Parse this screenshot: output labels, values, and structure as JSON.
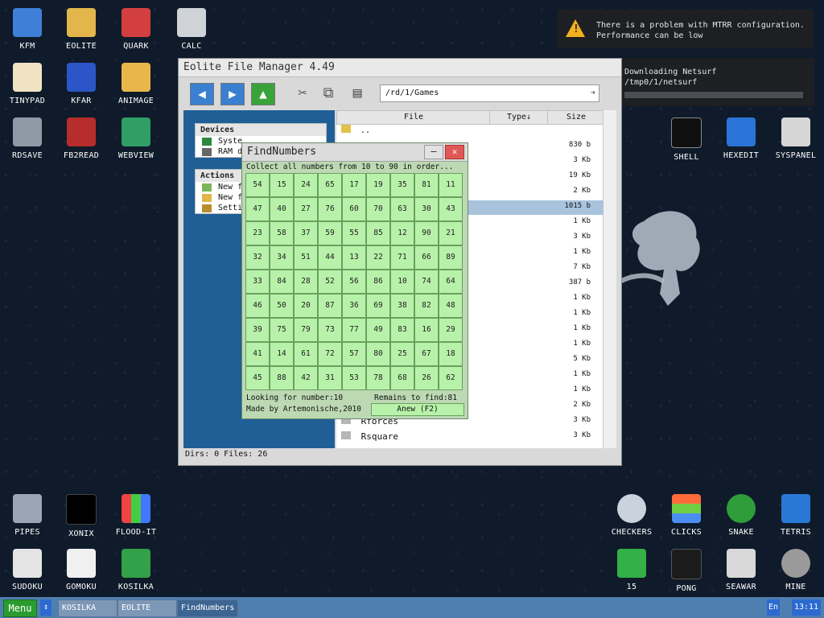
{
  "desktop": {
    "icons": [
      {
        "label": "KFM"
      },
      {
        "label": "EOLITE"
      },
      {
        "label": "QUARK"
      },
      {
        "label": "CALC"
      },
      {
        "label": "TINYPAD"
      },
      {
        "label": "KFAR"
      },
      {
        "label": "ANIMAGE"
      },
      {
        "label": "RDSAVE"
      },
      {
        "label": "FB2READ"
      },
      {
        "label": "WEBVIEW"
      },
      {
        "label": "SHELL"
      },
      {
        "label": "HEXEDIT"
      },
      {
        "label": "SYSPANEL"
      },
      {
        "label": "PIPES"
      },
      {
        "label": "XONIX"
      },
      {
        "label": "FLOOD-IT"
      },
      {
        "label": "SUDOKU"
      },
      {
        "label": "GOMOKU"
      },
      {
        "label": "KOSILKA"
      },
      {
        "label": "CHECKERS"
      },
      {
        "label": "CLICKS"
      },
      {
        "label": "SNAKE"
      },
      {
        "label": "TETRIS"
      },
      {
        "label": "15"
      },
      {
        "label": "PONG"
      },
      {
        "label": "SEAWAR"
      },
      {
        "label": "MINE"
      }
    ]
  },
  "notifications": {
    "mtrr": {
      "line1": "There is a problem with MTRR configuration.",
      "line2": "Performance can be low"
    },
    "download": {
      "title": "Downloading Netsurf",
      "path": "/tmp0/1/netsurf"
    }
  },
  "file_manager": {
    "title": "Eolite File Manager 4.49",
    "path": "/rd/1/Games",
    "devices_header": "Devices",
    "device_1": "Syste",
    "device_2": "RAM d",
    "actions_header": "Actions",
    "action_1": "New f",
    "action_2": "New f",
    "action_3": "Setti",
    "col_file": "File",
    "col_type": "Type↓",
    "col_size": "Size",
    "parent_row": "..",
    "sizes": [
      "830 b",
      "3 Kb",
      "19 Kb",
      "2 Kb",
      "1015 b",
      "1 Kb",
      "3 Kb",
      "1 Kb",
      "7 Kb",
      "387 b",
      "1 Kb",
      "1 Kb",
      "1 Kb",
      "1 Kb",
      "5 Kb",
      "1 Kb",
      "1 Kb",
      "2 Kb",
      "3 Kb",
      "3 Kb"
    ],
    "file_rforces": "Rforces",
    "file_rsquare": "Rsquare",
    "status": "Dirs: 0  Files: 26"
  },
  "findnumbers": {
    "title": "FindNumbers",
    "instructions": "Collect all numbers from 10 to 90 in order...",
    "grid": [
      [
        "54",
        "15",
        "24",
        "65",
        "17",
        "19",
        "35",
        "81",
        "11"
      ],
      [
        "47",
        "40",
        "27",
        "76",
        "60",
        "70",
        "63",
        "30",
        "43"
      ],
      [
        "23",
        "58",
        "37",
        "59",
        "55",
        "85",
        "12",
        "90",
        "21"
      ],
      [
        "32",
        "34",
        "51",
        "44",
        "13",
        "22",
        "71",
        "66",
        "89"
      ],
      [
        "33",
        "84",
        "28",
        "52",
        "56",
        "86",
        "10",
        "74",
        "64"
      ],
      [
        "46",
        "50",
        "20",
        "87",
        "36",
        "69",
        "38",
        "82",
        "48"
      ],
      [
        "39",
        "75",
        "79",
        "73",
        "77",
        "49",
        "83",
        "16",
        "29"
      ],
      [
        "41",
        "14",
        "61",
        "72",
        "57",
        "80",
        "25",
        "67",
        "18"
      ],
      [
        "45",
        "88",
        "42",
        "31",
        "53",
        "78",
        "68",
        "26",
        "62"
      ]
    ],
    "looking_for": "Looking for number:10",
    "remains": "Remains to find:81",
    "credit": "Made by Artemonische,2010",
    "anew_button": "Anew (F2)"
  },
  "taskbar": {
    "menu": "Menu",
    "tasks": [
      "KOSILKA",
      "EOLITE",
      "FindNumbers"
    ],
    "lang": "En",
    "clock": "13:11"
  }
}
